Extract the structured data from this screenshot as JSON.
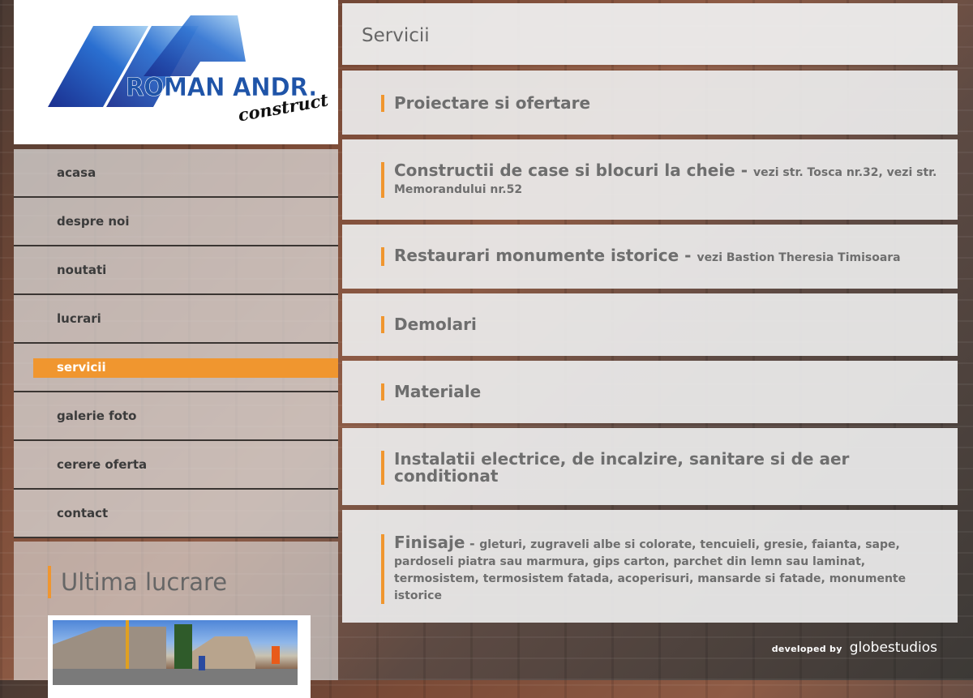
{
  "logo": {
    "title": "ROMAN ANDR.",
    "subtitle": "construct"
  },
  "nav": {
    "items": [
      {
        "label": "acasa"
      },
      {
        "label": "despre noi"
      },
      {
        "label": "noutati"
      },
      {
        "label": "lucrari"
      },
      {
        "label": "servicii",
        "active": true
      },
      {
        "label": "galerie foto"
      },
      {
        "label": "cerere oferta"
      },
      {
        "label": "contact"
      }
    ]
  },
  "latest": {
    "title": "Ultima lucrare"
  },
  "page": {
    "title": "Servicii"
  },
  "services": [
    {
      "title": "Proiectare si ofertare",
      "detail": ""
    },
    {
      "title": "Constructii de case si blocuri la cheie",
      "detail": "vezi str. Tosca nr.32, vezi str. Memorandului nr.52"
    },
    {
      "title": "Restaurari monumente istorice",
      "detail": "vezi Bastion Theresia Timisoara"
    },
    {
      "title": "Demolari",
      "detail": ""
    },
    {
      "title": "Materiale",
      "detail": ""
    },
    {
      "title": "Instalatii electrice, de incalzire, sanitare si de aer conditionat",
      "detail": ""
    },
    {
      "title": "Finisaje",
      "detail": "gleturi, zugraveli albe si colorate, tencuieli, gresie, faianta, sape, pardoseli piatra sau marmura, gips carton, parchet din lemn sau laminat, termosistem, termosistem fatada, acoperisuri, mansarde si fatade, monumente istorice"
    }
  ],
  "footer": {
    "developed_by": "developed by",
    "brand": "globestudios"
  },
  "colors": {
    "accent": "#f0962f",
    "logo_blue": "#1f54a8"
  }
}
